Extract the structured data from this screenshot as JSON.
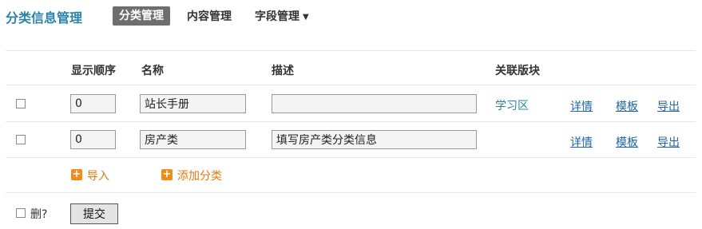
{
  "header": {
    "title": "分类信息管理",
    "tabs": [
      {
        "label": "分类管理",
        "active": true
      },
      {
        "label": "内容管理",
        "active": false
      },
      {
        "label": "字段管理",
        "active": false
      }
    ]
  },
  "table": {
    "columns": [
      "显示顺序",
      "名称",
      "描述",
      "关联版块"
    ],
    "rows": [
      {
        "order": "0",
        "name": "站长手册",
        "description": "",
        "forum": "学习区",
        "actions": [
          "详情",
          "模板",
          "导出"
        ]
      },
      {
        "order": "0",
        "name": "房产类",
        "description": "填写房产类分类信息",
        "forum": "",
        "actions": [
          "详情",
          "模板",
          "导出"
        ]
      }
    ]
  },
  "footer_actions": {
    "import_label": "导入",
    "add_label": "添加分类"
  },
  "form": {
    "delete_label": "删?",
    "submit_label": "提交"
  },
  "colors": {
    "accent": "#2a82a8",
    "active_tab_bg": "#6e6e6e",
    "action_orange": "#f08c1c"
  },
  "icons": {
    "add": "plus-icon",
    "dropdown": "caret-down-icon"
  }
}
